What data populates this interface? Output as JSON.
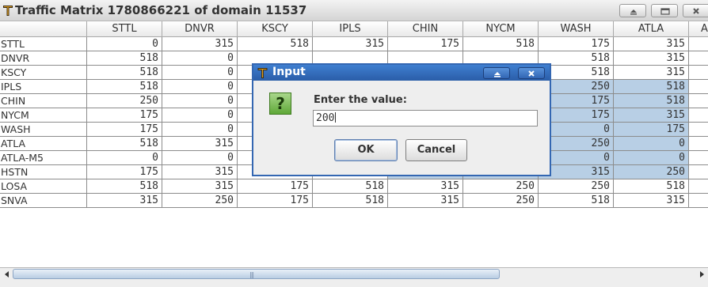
{
  "window": {
    "title": "Traffic Matrix 1780866221 of domain 11537",
    "buttons": [
      "minimize-button",
      "maximize-button",
      "close-button"
    ]
  },
  "table": {
    "columns": [
      "STTL",
      "DNVR",
      "KSCY",
      "IPLS",
      "CHIN",
      "NYCM",
      "WASH",
      "ATLA",
      "A"
    ],
    "rows": [
      {
        "name": "STTL",
        "values": [
          "0",
          "315",
          "518",
          "315",
          "175",
          "518",
          "175",
          "315"
        ]
      },
      {
        "name": "DNVR",
        "values": [
          "518",
          "0",
          "",
          "",
          "",
          "",
          "518",
          "315"
        ]
      },
      {
        "name": "KSCY",
        "values": [
          "518",
          "0",
          "",
          "",
          "",
          "",
          "518",
          "315"
        ]
      },
      {
        "name": "IPLS",
        "values": [
          "518",
          "0",
          "",
          "",
          "",
          "",
          "250",
          "518"
        ]
      },
      {
        "name": "CHIN",
        "values": [
          "250",
          "0",
          "",
          "",
          "",
          "",
          "175",
          "518"
        ]
      },
      {
        "name": "NYCM",
        "values": [
          "175",
          "0",
          "",
          "",
          "",
          "",
          "175",
          "315"
        ]
      },
      {
        "name": "WASH",
        "values": [
          "175",
          "0",
          "",
          "",
          "",
          "",
          "0",
          "175"
        ]
      },
      {
        "name": "ATLA",
        "values": [
          "518",
          "315",
          "",
          "",
          "",
          "",
          "250",
          "0"
        ]
      },
      {
        "name": "ATLA-M5",
        "values": [
          "0",
          "0",
          "",
          "",
          "",
          "",
          "0",
          "0"
        ]
      },
      {
        "name": "HSTN",
        "values": [
          "175",
          "315",
          "250",
          "315",
          "518",
          "175",
          "315",
          "250"
        ]
      },
      {
        "name": "LOSA",
        "values": [
          "518",
          "315",
          "175",
          "518",
          "315",
          "250",
          "250",
          "518"
        ]
      },
      {
        "name": "SNVA",
        "values": [
          "315",
          "250",
          "175",
          "518",
          "315",
          "250",
          "518",
          "315"
        ]
      }
    ]
  },
  "dialog": {
    "title": "Input",
    "prompt": "Enter the value:",
    "input_value": "200",
    "ok_label": "OK",
    "cancel_label": "Cancel",
    "icon": "question-icon"
  },
  "colors": {
    "selection": "#b8cfe5",
    "dialog_title": "#2f63b0"
  }
}
